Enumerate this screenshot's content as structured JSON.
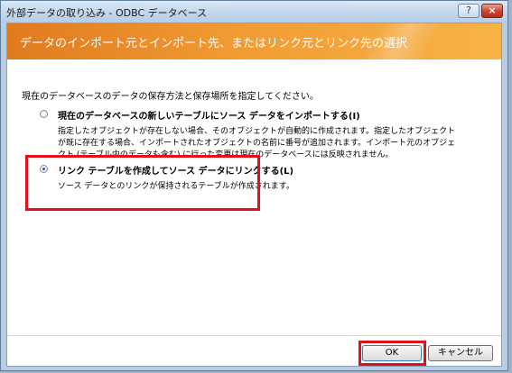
{
  "window": {
    "title": "外部データの取り込み - ODBC データベース",
    "help_label": "?",
    "close_label": "×"
  },
  "banner": {
    "title": "データのインポート元とインポート先、またはリンク元とリンク先の選択"
  },
  "instruction": "現在のデータベースのデータの保存方法と保存場所を指定してください。",
  "options": [
    {
      "label": "現在のデータベースの新しいテーブルにソース データをインポートする(I)",
      "description": "指定したオブジェクトが存在しない場合、そのオブジェクトが自動的に作成されます。指定したオブジェクトが既に存在する場合、インポートされたオブジェクトの名前に番号が追加されます。インポート元のオブジェクト (テーブル内のデータも含む) に行った変更は現在のデータベースには反映されません。",
      "selected": false
    },
    {
      "label": "リンク テーブルを作成してソース データにリンクする(L)",
      "description": "ソース データとのリンクが保持されるテーブルが作成されます。",
      "selected": true
    }
  ],
  "buttons": {
    "ok": "OK",
    "cancel": "キャンセル"
  },
  "colors": {
    "banner_orange": "#f19a33",
    "highlight_red": "#e0101a",
    "window_frame": "#b9cde3"
  }
}
